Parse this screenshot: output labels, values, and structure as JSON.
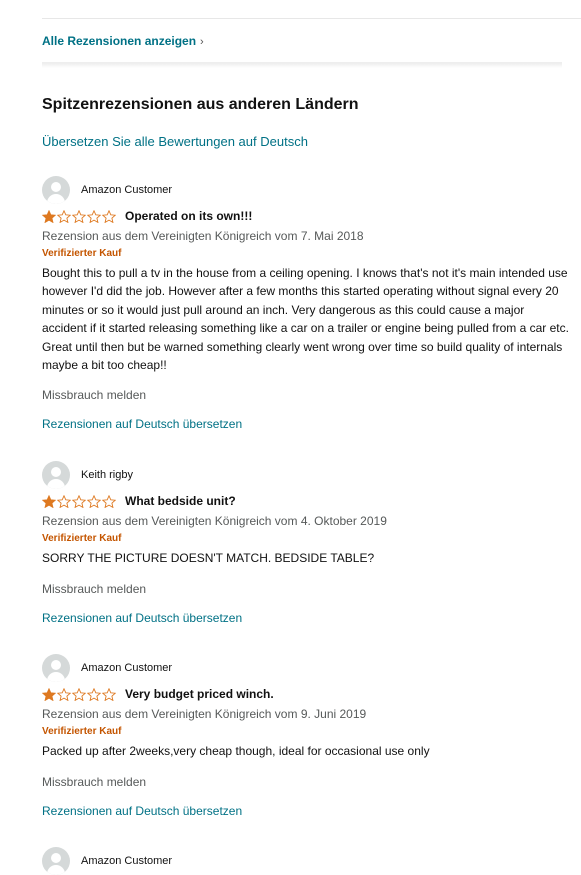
{
  "header": {
    "see_all_reviews": "Alle Rezensionen anzeigen",
    "see_all_chevron": "›"
  },
  "section": {
    "title": "Spitzenrezensionen aus anderen Ländern",
    "translate_all": "Übersetzen Sie alle Bewertungen auf Deutsch"
  },
  "colors": {
    "link": "#007185",
    "star": "#de7921",
    "verified": "#c45500",
    "muted": "#565959"
  },
  "icons": {
    "avatar": "default-profile-icon",
    "star_full": "star-filled-icon",
    "star_empty": "star-empty-icon"
  },
  "reviews": [
    {
      "name": "Amazon Customer",
      "rating": 1,
      "title": "Operated on its own!!!",
      "meta": "Rezension aus dem Vereinigten Königreich vom 7. Mai 2018",
      "verified": "Verifizierter Kauf",
      "body": "Bought this to pull a tv in the house from a ceiling opening. I knows that's not it's main intended use however I'd did the job. However after a few months this started operating without signal every 20 minutes or so it would just pull around an inch. Very dangerous as this could cause a major accident if it started releasing something like a car on a trailer or engine being pulled from a car etc. Great until then but be warned something clearly went wrong over time so build quality of internals maybe a bit too cheap!!",
      "report": "Missbrauch melden",
      "translate": "Rezensionen auf Deutsch übersetzen"
    },
    {
      "name": "Keith rigby",
      "rating": 1,
      "title": "What bedside unit?",
      "meta": "Rezension aus dem Vereinigten Königreich vom 4. Oktober 2019",
      "verified": "Verifizierter Kauf",
      "body": "SORRY THE PICTURE DOESN'T MATCH. BEDSIDE TABLE?",
      "report": "Missbrauch melden",
      "translate": "Rezensionen auf Deutsch übersetzen"
    },
    {
      "name": "Amazon Customer",
      "rating": 1,
      "title": "Very budget priced winch.",
      "meta": "Rezension aus dem Vereinigten Königreich vom 9. Juni 2019",
      "verified": "Verifizierter Kauf",
      "body": "Packed up after 2weeks,very cheap though, ideal for occasional use only",
      "report": "Missbrauch melden",
      "translate": "Rezensionen auf Deutsch übersetzen"
    },
    {
      "name": "Amazon Customer"
    }
  ]
}
